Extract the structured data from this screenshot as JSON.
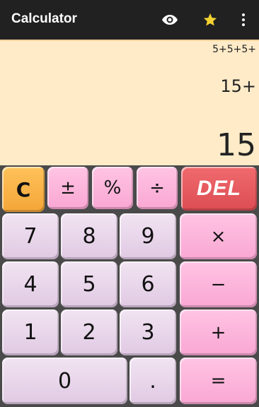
{
  "app": {
    "title": "Calculator"
  },
  "toolbar": {
    "icons": [
      "eye-icon",
      "star-icon",
      "more-vert-icon"
    ],
    "star_color": "#f4d231"
  },
  "display": {
    "history": "5+5+5+",
    "expression": "15+",
    "result": "15"
  },
  "keys": {
    "clear": "C",
    "plus_minus": "±",
    "percent": "%",
    "divide": "÷",
    "delete": "DEL",
    "seven": "7",
    "eight": "8",
    "nine": "9",
    "multiply": "×",
    "four": "4",
    "five": "5",
    "six": "6",
    "minus": "−",
    "one": "1",
    "two": "2",
    "three": "3",
    "plus": "+",
    "zero": "0",
    "dot": ".",
    "equals": "="
  },
  "colors": {
    "appbar": "#212121",
    "display_bg": "#ffebc8",
    "number_key": "#e8d6ea",
    "operator_key": "#fbb6da",
    "clear_key": "#f9b548",
    "delete_key": "#e65c61"
  }
}
